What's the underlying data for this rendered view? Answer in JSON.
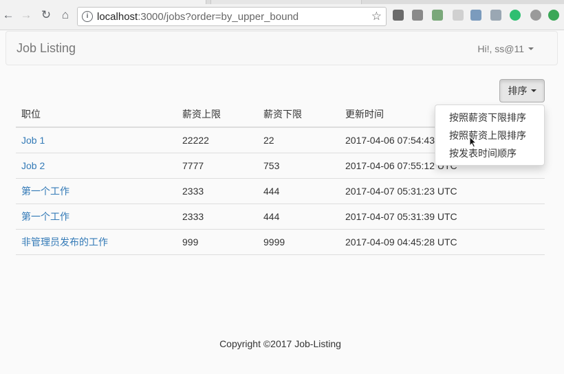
{
  "browser": {
    "url_host": "localhost",
    "url_rest": ":3000/jobs?order=by_upper_bound",
    "info_glyph": "i",
    "back_glyph": "←",
    "forward_glyph": "→",
    "reload_glyph": "↻",
    "home_glyph": "⌂",
    "star_glyph": "☆"
  },
  "navbar": {
    "brand": "Job Listing",
    "user_label": "Hi!, ss@11"
  },
  "sort": {
    "button_label": "排序",
    "options": [
      "按照薪资下限排序",
      "按照薪资上限排序",
      "按发表时间顺序"
    ]
  },
  "table": {
    "headers": [
      "职位",
      "薪资上限",
      "薪资下限",
      "更新时间"
    ],
    "rows": [
      {
        "title": "Job 1",
        "upper": "22222",
        "lower": "22",
        "updated": "2017-04-06 07:54:43 UTC"
      },
      {
        "title": "Job 2",
        "upper": "7777",
        "lower": "753",
        "updated": "2017-04-06 07:55:12 UTC"
      },
      {
        "title": "第一个工作",
        "upper": "2333",
        "lower": "444",
        "updated": "2017-04-07 05:31:23 UTC"
      },
      {
        "title": "第一个工作",
        "upper": "2333",
        "lower": "444",
        "updated": "2017-04-07 05:31:39 UTC"
      },
      {
        "title": "非管理员发布的工作",
        "upper": "999",
        "lower": "9999",
        "updated": "2017-04-09 04:45:28 UTC"
      }
    ]
  },
  "footer": {
    "text": "Copyright ©2017 Job-Listing"
  },
  "extensions": [
    {
      "name": "tree-extension-icon",
      "color": "#6b6b6b"
    },
    {
      "name": "pocket-icon",
      "color": "#8a8a8a"
    },
    {
      "name": "evernote-icon",
      "color": "#7aa87a"
    },
    {
      "name": "shield-extension-icon",
      "color": "#d0d0d0"
    },
    {
      "name": "star-extension-icon",
      "color": "#7b9bbd"
    },
    {
      "name": "puzzle-extension-icon",
      "color": "#9aa7b3"
    },
    {
      "name": "grammarly-icon",
      "color": "#2fbf71"
    },
    {
      "name": "target-extension-icon",
      "color": "#9a9a9a"
    },
    {
      "name": "upload-extension-icon",
      "color": "#3aa757"
    }
  ]
}
